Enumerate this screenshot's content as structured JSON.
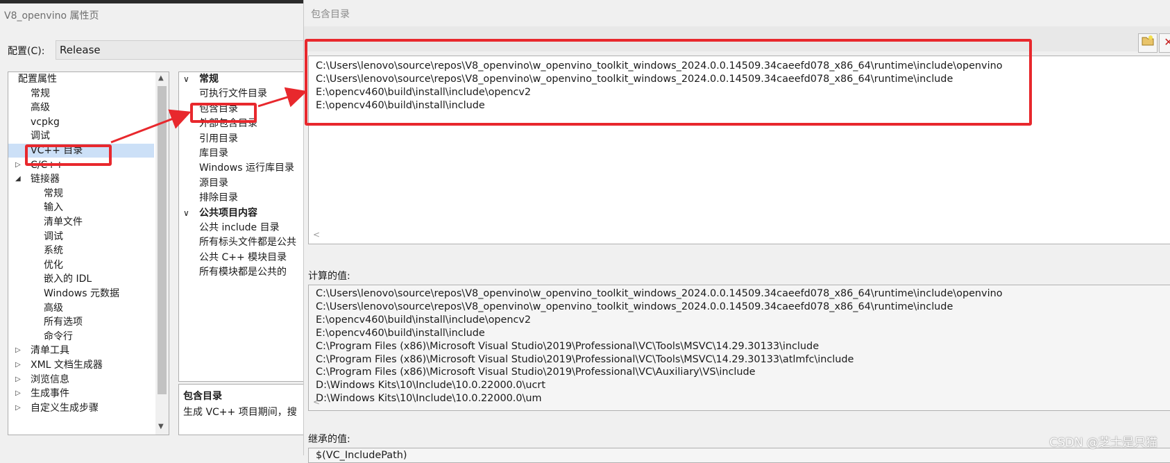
{
  "window_title": "V8_openvino 属性页",
  "config": {
    "label": "配置(C):",
    "value": "Release"
  },
  "tree": {
    "items": [
      {
        "label": "配置属性",
        "glyph": "◢",
        "level": 0
      },
      {
        "label": "常规",
        "glyph": "",
        "level": 1
      },
      {
        "label": "高级",
        "glyph": "",
        "level": 1
      },
      {
        "label": "vcpkg",
        "glyph": "",
        "level": 1
      },
      {
        "label": "调试",
        "glyph": "",
        "level": 1
      },
      {
        "label": "VC++ 目录",
        "glyph": "",
        "level": 1,
        "selected": true
      },
      {
        "label": "C/C++",
        "glyph": "▷",
        "level": 1
      },
      {
        "label": "链接器",
        "glyph": "◢",
        "level": 1
      },
      {
        "label": "常规",
        "glyph": "",
        "level": 2
      },
      {
        "label": "输入",
        "glyph": "",
        "level": 2
      },
      {
        "label": "清单文件",
        "glyph": "",
        "level": 2
      },
      {
        "label": "调试",
        "glyph": "",
        "level": 2
      },
      {
        "label": "系统",
        "glyph": "",
        "level": 2
      },
      {
        "label": "优化",
        "glyph": "",
        "level": 2
      },
      {
        "label": "嵌入的 IDL",
        "glyph": "",
        "level": 2
      },
      {
        "label": "Windows 元数据",
        "glyph": "",
        "level": 2
      },
      {
        "label": "高级",
        "glyph": "",
        "level": 2
      },
      {
        "label": "所有选项",
        "glyph": "",
        "level": 2
      },
      {
        "label": "命令行",
        "glyph": "",
        "level": 2
      },
      {
        "label": "清单工具",
        "glyph": "▷",
        "level": 1
      },
      {
        "label": "XML 文档生成器",
        "glyph": "▷",
        "level": 1
      },
      {
        "label": "浏览信息",
        "glyph": "▷",
        "level": 1
      },
      {
        "label": "生成事件",
        "glyph": "▷",
        "level": 1
      },
      {
        "label": "自定义生成步骤",
        "glyph": "▷",
        "level": 1
      }
    ],
    "scroll_up": "▲",
    "scroll_down": "▼"
  },
  "properties": {
    "rows": [
      {
        "label": "常规",
        "category": true,
        "glyph": "∨"
      },
      {
        "label": "可执行文件目录"
      },
      {
        "label": "包含目录"
      },
      {
        "label": "外部包含目录"
      },
      {
        "label": "引用目录"
      },
      {
        "label": "库目录"
      },
      {
        "label": "Windows 运行库目录"
      },
      {
        "label": "源目录"
      },
      {
        "label": "排除目录"
      },
      {
        "label": "公共项目内容",
        "category": true,
        "glyph": "∨"
      },
      {
        "label": "公共 include 目录"
      },
      {
        "label": "所有标头文件都是公共"
      },
      {
        "label": "公共 C++ 模块目录"
      },
      {
        "label": "所有模块都是公共的"
      }
    ]
  },
  "description": {
    "title": "包含目录",
    "text": "生成 VC++ 项目期间，搜"
  },
  "dialog": {
    "title": "包含目录",
    "toolbar": {
      "new_line_icon": "folder-add-icon",
      "delete_icon": "delete-icon"
    },
    "entries": [
      "C:\\Users\\lenovo\\source\\repos\\V8_openvino\\w_openvino_toolkit_windows_2024.0.0.14509.34caeefd078_x86_64\\runtime\\include\\openvino",
      "C:\\Users\\lenovo\\source\\repos\\V8_openvino\\w_openvino_toolkit_windows_2024.0.0.14509.34caeefd078_x86_64\\runtime\\include",
      "E:\\opencv460\\build\\install\\include\\opencv2",
      "E:\\opencv460\\build\\install\\include"
    ],
    "calc_label": "计算的值:",
    "calc_values": [
      "C:\\Users\\lenovo\\source\\repos\\V8_openvino\\w_openvino_toolkit_windows_2024.0.0.14509.34caeefd078_x86_64\\runtime\\include\\openvino",
      "C:\\Users\\lenovo\\source\\repos\\V8_openvino\\w_openvino_toolkit_windows_2024.0.0.14509.34caeefd078_x86_64\\runtime\\include",
      "E:\\opencv460\\build\\install\\include\\opencv2",
      "E:\\opencv460\\build\\install\\include",
      "C:\\Program Files (x86)\\Microsoft Visual Studio\\2019\\Professional\\VC\\Tools\\MSVC\\14.29.30133\\include",
      "C:\\Program Files (x86)\\Microsoft Visual Studio\\2019\\Professional\\VC\\Tools\\MSVC\\14.29.30133\\atlmfc\\include",
      "C:\\Program Files (x86)\\Microsoft Visual Studio\\2019\\Professional\\VC\\Auxiliary\\VS\\include",
      "D:\\Windows Kits\\10\\Include\\10.0.22000.0\\ucrt",
      "D:\\Windows Kits\\10\\Include\\10.0.22000.0\\um"
    ],
    "inherited_label": "继承的值:",
    "inherited_values": [
      "$(VC_IncludePath)"
    ]
  },
  "watermark": "CSDN @芝士是只猫",
  "annotation_color": "#e8282d"
}
